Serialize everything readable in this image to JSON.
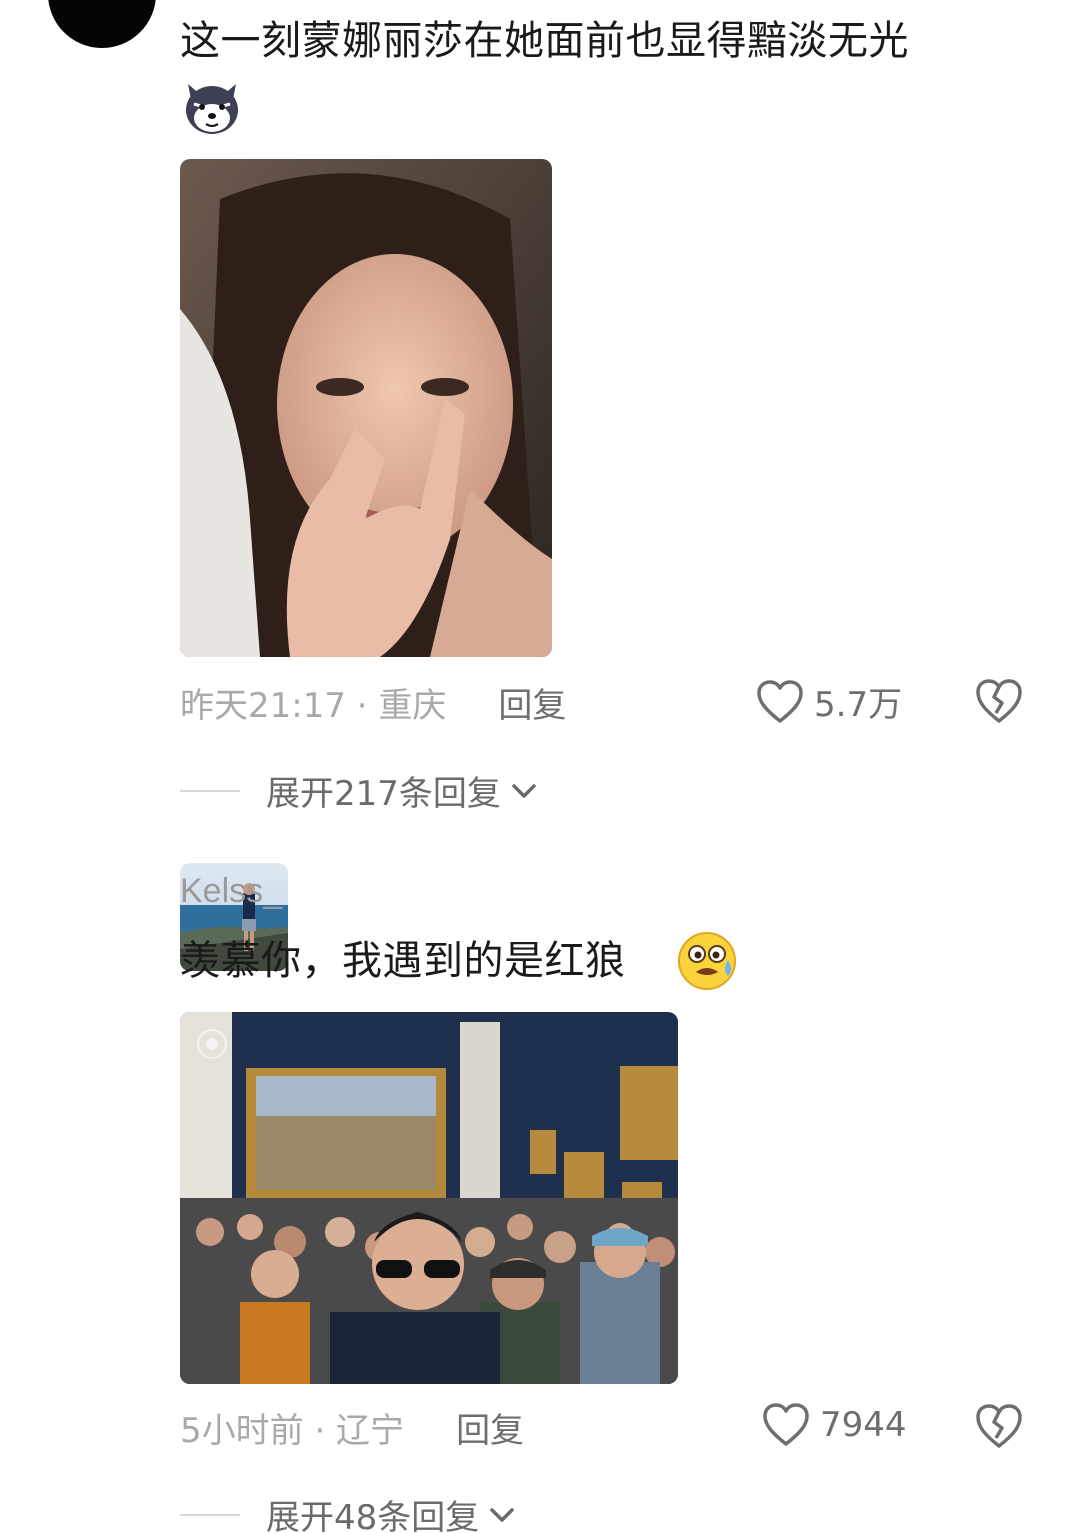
{
  "comments": [
    {
      "text": "这一刻蒙娜丽莎在她面前也显得黯淡无光",
      "time_location": "昨天21:17 · 重庆",
      "reply_label": "回复",
      "likes": "5.7万",
      "expand_label": "展开217条回复"
    },
    {
      "username": "Kelss_",
      "text": "羡慕你，我遇到的是红狼",
      "time_location": "5小时前 · 辽宁",
      "reply_label": "回复",
      "likes": "7944",
      "expand_label": "展开48条回复"
    }
  ],
  "icons": {
    "like": "heart-outline-icon",
    "dislike": "broken-heart-icon",
    "expand": "chevron-down-icon",
    "emoji_1": "wolf-emoji-icon",
    "emoji_2": "sweat-smile-emoji-icon"
  },
  "colors": {
    "text": "#1a1a1a",
    "meta": "#a3a3a3",
    "action": "#6e6e6e"
  }
}
